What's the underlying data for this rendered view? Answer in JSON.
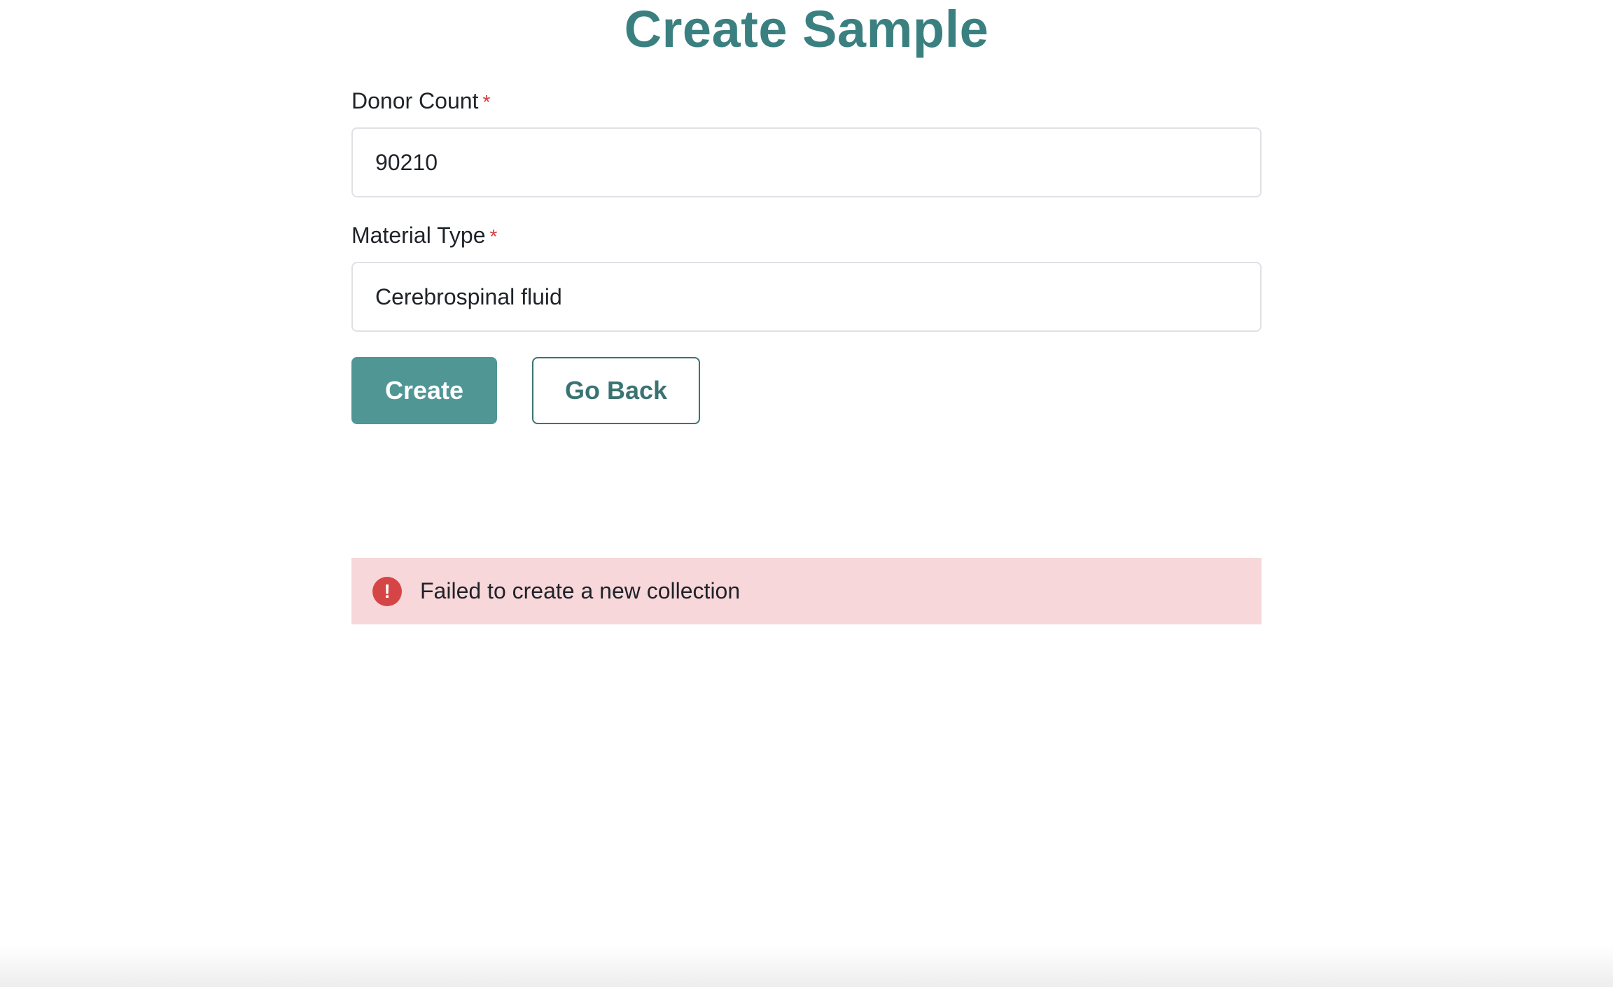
{
  "page": {
    "title": "Create Sample"
  },
  "form": {
    "donor_count": {
      "label": "Donor Count",
      "required_marker": "*",
      "value": "90210"
    },
    "material_type": {
      "label": "Material Type",
      "required_marker": "*",
      "value": "Cerebrospinal fluid"
    },
    "actions": {
      "create_label": "Create",
      "go_back_label": "Go Back"
    }
  },
  "alert": {
    "type": "error",
    "icon": "exclamation-circle-icon",
    "icon_glyph": "!",
    "message": "Failed to create a new collection"
  },
  "colors": {
    "title": "#3b8080",
    "primary_button": "#4f9695",
    "secondary_button_border": "#3b7373",
    "required": "#d63b3b",
    "alert_background": "#f8d7da",
    "alert_icon": "#d64545"
  }
}
